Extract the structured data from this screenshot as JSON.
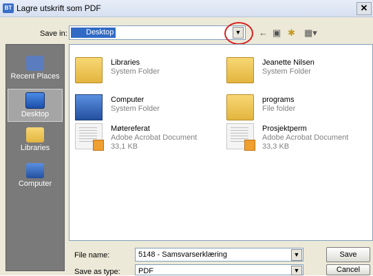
{
  "window": {
    "title": "Lagre utskrift som PDF",
    "app_icon_text": "BT",
    "close_symbol": "✕"
  },
  "save_in": {
    "label": "Save in:",
    "value": "Desktop"
  },
  "toolbar": {
    "icons": [
      "back-arrow-icon",
      "up-folder-icon",
      "new-folder-icon",
      "view-menu-icon"
    ]
  },
  "places": [
    {
      "label": "Recent Places",
      "icon": "recent-places-icon",
      "active": false
    },
    {
      "label": "Desktop",
      "icon": "desktop-icon",
      "active": true
    },
    {
      "label": "Libraries",
      "icon": "libraries-icon",
      "active": false
    },
    {
      "label": "Computer",
      "icon": "computer-icon",
      "active": false
    }
  ],
  "files": [
    {
      "name": "Libraries",
      "type": "System Folder",
      "size": "",
      "icon": "libraries-folder-icon"
    },
    {
      "name": "Jeanette Nilsen",
      "type": "System Folder",
      "size": "",
      "icon": "user-folder-icon"
    },
    {
      "name": "Computer",
      "type": "System Folder",
      "size": "",
      "icon": "computer-icon"
    },
    {
      "name": "programs",
      "type": "File folder",
      "size": "",
      "icon": "folder-icon"
    },
    {
      "name": "Møtereferat",
      "type": "Adobe Acrobat Document",
      "size": "33,1 KB",
      "icon": "pdf-document-icon"
    },
    {
      "name": "Prosjektperm",
      "type": "Adobe Acrobat Document",
      "size": "33,3 KB",
      "icon": "pdf-document-icon"
    }
  ],
  "filename": {
    "label": "File name:",
    "value": "5148 - Samsvarserklæring"
  },
  "savetype": {
    "label": "Save as type:",
    "value": "PDF"
  },
  "buttons": {
    "save": "Save",
    "cancel": "Cancel"
  },
  "colors": {
    "annotation": "#d62020",
    "selection": "#316ac5",
    "sidebar": "#7a7a7a"
  }
}
